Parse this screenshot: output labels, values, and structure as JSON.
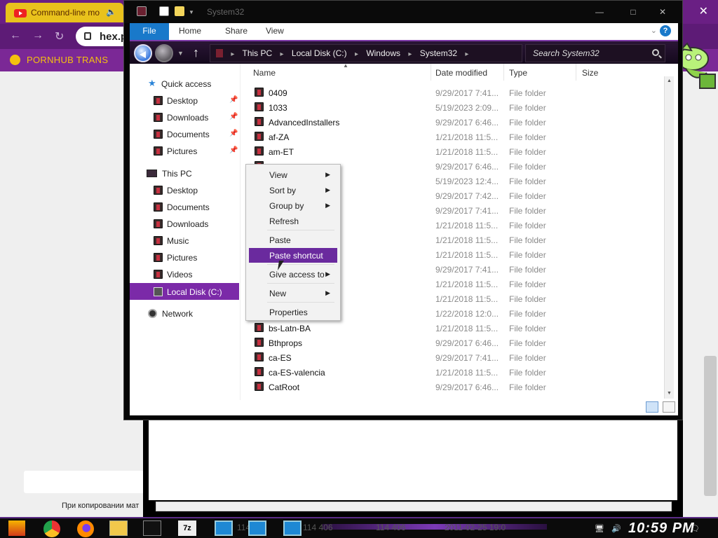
{
  "browser": {
    "tab_title": "Command-line mo",
    "url_text": "hex.p",
    "bookmark": "PORNHUB TRANS",
    "russian_text": "При копировании мат"
  },
  "explorer": {
    "window_title": "System32",
    "ribbon_tabs": [
      "File",
      "Home",
      "Share",
      "View"
    ],
    "breadcrumbs": [
      "This PC",
      "Local Disk (C:)",
      "Windows",
      "System32"
    ],
    "search_placeholder": "Search System32",
    "nav": {
      "quick_access": "Quick access",
      "qa_items": [
        "Desktop",
        "Downloads",
        "Documents",
        "Pictures"
      ],
      "this_pc": "This PC",
      "pc_items": [
        "Desktop",
        "Documents",
        "Downloads",
        "Music",
        "Pictures",
        "Videos"
      ],
      "local_disk": "Local Disk (C:)",
      "network": "Network"
    },
    "columns": [
      "Name",
      "Date modified",
      "Type",
      "Size"
    ],
    "files": [
      {
        "name": "0409",
        "date": "9/29/2017 7:41...",
        "type": "File folder"
      },
      {
        "name": "1033",
        "date": "5/19/2023 2:09...",
        "type": "File folder"
      },
      {
        "name": "AdvancedInstallers",
        "date": "9/29/2017 6:46...",
        "type": "File folder"
      },
      {
        "name": "af-ZA",
        "date": "1/21/2018 11:5...",
        "type": "File folder"
      },
      {
        "name": "am-ET",
        "date": "1/21/2018 11:5...",
        "type": "File folder"
      },
      {
        "name": "",
        "date": "9/29/2017 6:46...",
        "type": "File folder"
      },
      {
        "name": "",
        "date": "5/19/2023 12:4...",
        "type": "File folder"
      },
      {
        "name": "",
        "date": "9/29/2017 7:42...",
        "type": "File folder"
      },
      {
        "name": "",
        "date": "9/29/2017 7:41...",
        "type": "File folder"
      },
      {
        "name": "",
        "date": "1/21/2018 11:5...",
        "type": "File folder"
      },
      {
        "name": "",
        "date": "1/21/2018 11:5...",
        "type": "File folder"
      },
      {
        "name": "",
        "date": "1/21/2018 11:5...",
        "type": "File folder"
      },
      {
        "name": "",
        "date": "9/29/2017 7:41...",
        "type": "File folder"
      },
      {
        "name": "",
        "date": "1/21/2018 11:5...",
        "type": "File folder"
      },
      {
        "name": "",
        "date": "1/21/2018 11:5...",
        "type": "File folder"
      },
      {
        "name": "",
        "date": "1/22/2018 12:0...",
        "type": "File folder"
      },
      {
        "name": "bs-Latn-BA",
        "date": "1/21/2018 11:5...",
        "type": "File folder"
      },
      {
        "name": "Bthprops",
        "date": "9/29/2017 6:46...",
        "type": "File folder"
      },
      {
        "name": "ca-ES",
        "date": "9/29/2017 7:41...",
        "type": "File folder"
      },
      {
        "name": "ca-ES-valencia",
        "date": "1/21/2018 11:5...",
        "type": "File folder"
      },
      {
        "name": "CatRoot",
        "date": "9/29/2017 6:46...",
        "type": "File folder"
      }
    ]
  },
  "context_menu": {
    "items": [
      {
        "label": "View",
        "submenu": true
      },
      {
        "label": "Sort by",
        "submenu": true
      },
      {
        "label": "Group by",
        "submenu": true
      },
      {
        "label": "Refresh",
        "submenu": false
      },
      {
        "label": "Paste",
        "submenu": false
      },
      {
        "label": "Paste shortcut",
        "submenu": false,
        "highlighted": true
      },
      {
        "label": "Give access to",
        "submenu": true
      },
      {
        "label": "New",
        "submenu": true
      },
      {
        "label": "Properties",
        "submenu": false
      }
    ]
  },
  "taskbar": {
    "clock": "10:59 PM",
    "ghost_text": [
      "114 406",
      "114 406",
      "2011-02-25 19:0"
    ]
  },
  "colors": {
    "accent_purple": "#6a2a9e",
    "ribbon_file_blue": "#1979ca",
    "browser_purple": "#6a1f84",
    "bookmark_gold": "#f4c10f"
  }
}
